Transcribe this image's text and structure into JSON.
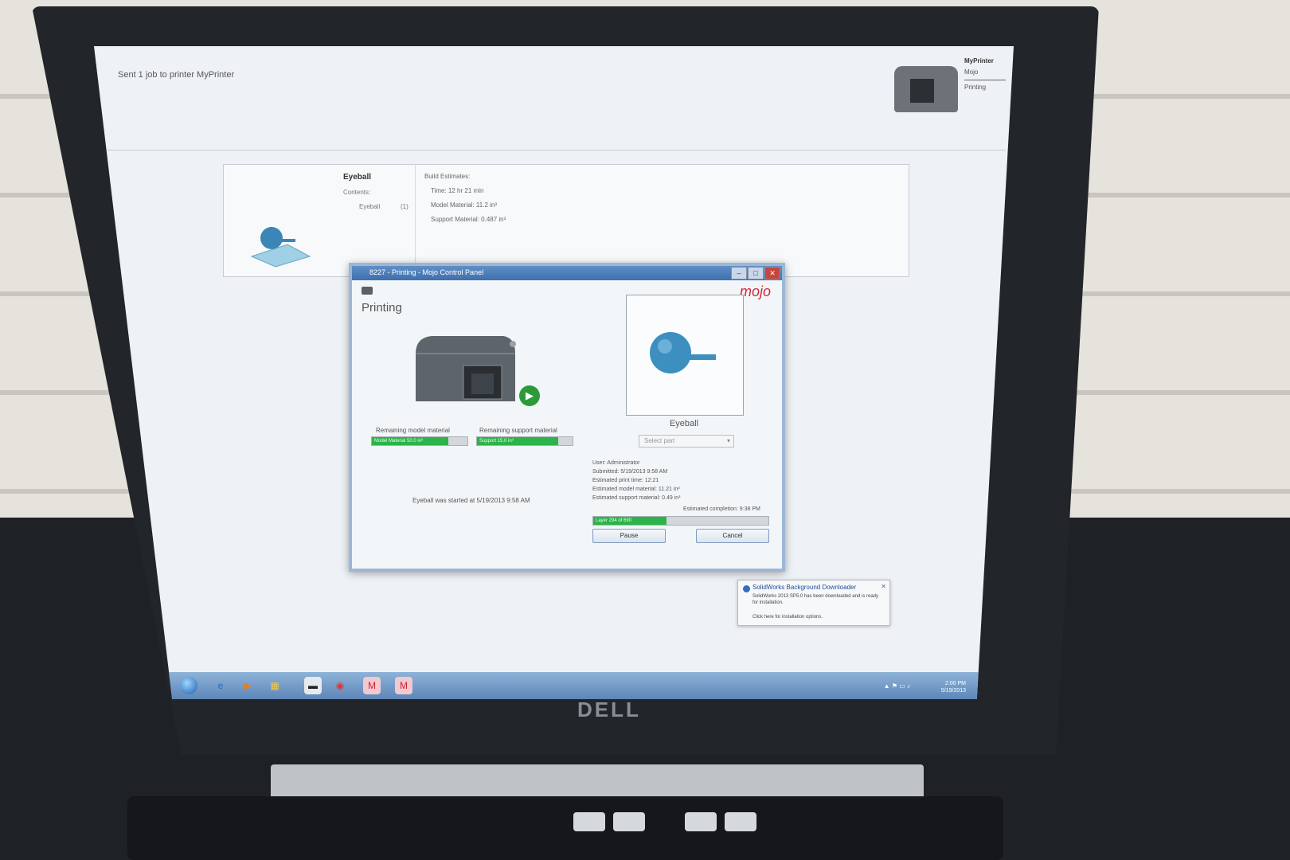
{
  "screen": {
    "sent_message": "Sent 1 job to printer MyPrinter",
    "printer_panel": {
      "name": "MyPrinter",
      "sub": "Mojo",
      "status": "Printing"
    }
  },
  "job_card": {
    "title": "Eyeball",
    "contents_label": "Contents:",
    "item_name": "Eyeball",
    "item_count": "(1)",
    "estimates_label": "Build Estimates:",
    "time": "Time:  12 hr 21 min",
    "model_material": "Model Material:  11.2 in³",
    "support_material": "Support Material:  0.487 in³"
  },
  "dialog": {
    "title": "8227 - Printing - Mojo Control Panel",
    "brand": "mojo",
    "heading": "Printing",
    "remaining_model_label": "Remaining model material",
    "remaining_support_label": "Remaining support material",
    "model_material_level": 0.8,
    "support_material_level": 0.85,
    "model_bar_text": "Model Material 50.0 in³",
    "support_bar_text": "Support 15.0 in³",
    "started_text": "Eyeball was started at 5/19/2013 9:58 AM",
    "preview_name": "Eyeball",
    "select_part": "Select part",
    "info": {
      "user": "User: Administrator",
      "submitted": "Submitted: 5/19/2013 9:58 AM",
      "estimated_time": "Estimated print time: 12:21",
      "estimated_model": "Estimated model material: 11.21 in³",
      "estimated_support": "Estimated support material: 0.49 in³"
    },
    "estimated_completion": "Estimated completion: 9:38 PM",
    "job_progress": 0.42,
    "job_progress_text": "Layer 294 of 690",
    "pause_button": "Pause",
    "cancel_button": "Cancel"
  },
  "notification": {
    "title": "SolidWorks Background Downloader",
    "body": "SolidWorks 2013 SP5.0 has been downloaded and is ready for installation.",
    "link": "Click here for installation options."
  },
  "taskbar": {
    "time": "2:00 PM",
    "date": "5/19/2013"
  },
  "monitor": {
    "brand": "DELL"
  }
}
